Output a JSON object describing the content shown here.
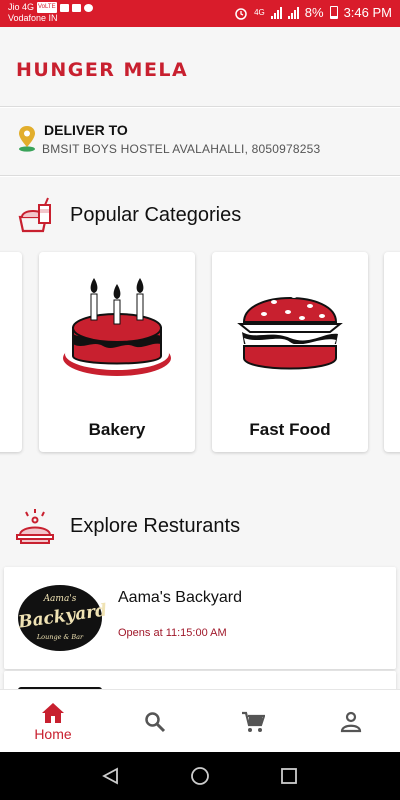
{
  "status_bar": {
    "carrier1": "Jio 4G",
    "volte": "VoLTE",
    "carrier2": "Vodafone IN",
    "network": "4G",
    "battery": "8%",
    "time": "3:46 PM"
  },
  "app": {
    "title": "HUNGER MELA",
    "brand_color": "#c8202f"
  },
  "deliver": {
    "title": "DELIVER TO",
    "address": "BMSIT BOYS HOSTEL AVALAHALLI, 8050978253",
    "icon": "location-pin-icon"
  },
  "categories": {
    "heading": "Popular Categories",
    "icon": "fast-food-icon",
    "items": [
      {
        "label": "Bakery",
        "icon": "cake-icon"
      },
      {
        "label": "Fast Food",
        "icon": "burger-icon"
      }
    ]
  },
  "restaurants": {
    "heading": "Explore Resturants",
    "icon": "food-cloche-icon",
    "items": [
      {
        "name": "Aama's Backyard",
        "status": "Opens at 11:15:00 AM",
        "logo_top": "Aama's",
        "logo_main": "Backyard",
        "logo_sub": "Lounge & Bar"
      }
    ]
  },
  "bottom_nav": {
    "home": "Home",
    "active_color": "#c8202f",
    "items": [
      "home-icon",
      "search-icon",
      "cart-icon",
      "profile-icon"
    ]
  }
}
